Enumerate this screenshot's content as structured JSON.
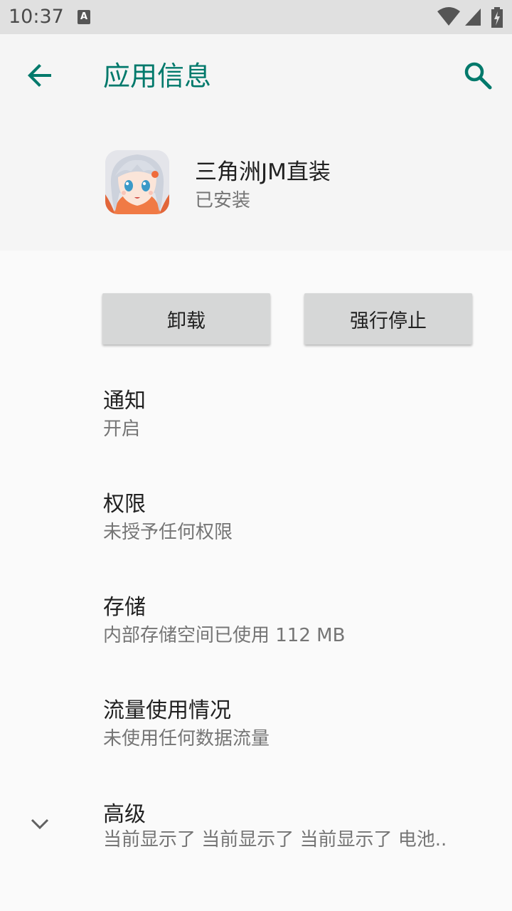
{
  "status_bar": {
    "time": "10:37",
    "notification_glyph": "A",
    "icons": [
      "wifi-icon",
      "cell-signal-icon",
      "battery-charging-icon"
    ]
  },
  "app_bar": {
    "title": "应用信息",
    "back_icon": "arrow-back-icon",
    "search_icon": "search-icon",
    "accent_color": "#00796b"
  },
  "app": {
    "name": "三角洲JM直装",
    "status": "已安装",
    "icon": "anime-girl-app-icon"
  },
  "buttons": {
    "uninstall": "卸载",
    "force_stop": "强行停止"
  },
  "settings": [
    {
      "title": "通知",
      "subtitle": "开启"
    },
    {
      "title": "权限",
      "subtitle": "未授予任何权限"
    },
    {
      "title": "存储",
      "subtitle": "内部存储空间已使用 112 MB"
    },
    {
      "title": "流量使用情况",
      "subtitle": "未使用任何数据流量"
    },
    {
      "title": "高级",
      "subtitle": "当前显示了 当前显示了 当前显示了 电池..",
      "icon": "chevron-down-icon"
    }
  ]
}
